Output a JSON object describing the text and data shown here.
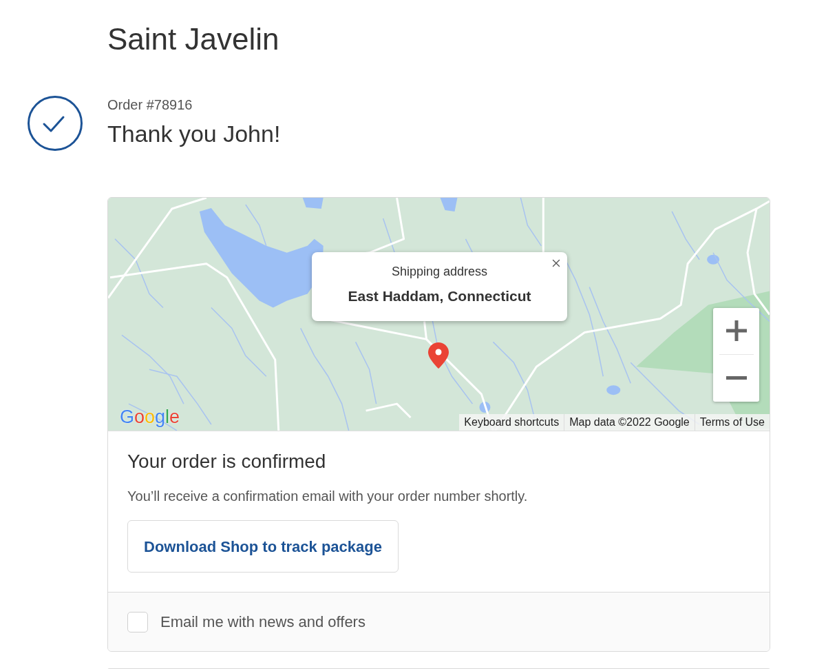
{
  "store": {
    "name": "Saint Javelin"
  },
  "order": {
    "number_label": "Order #78916",
    "greeting": "Thank you John!"
  },
  "map": {
    "popup": {
      "title": "Shipping address",
      "address": "East Haddam, Connecticut"
    },
    "logo": "Google",
    "attribution": [
      "Keyboard shortcuts",
      "Map data ©2022 Google",
      "Terms of Use"
    ]
  },
  "confirmation": {
    "title": "Your order is confirmed",
    "message": "You’ll receive a confirmation email with your order number shortly.",
    "button": "Download Shop to track package"
  },
  "marketing": {
    "label": "Email me with news and offers",
    "checked": false
  }
}
